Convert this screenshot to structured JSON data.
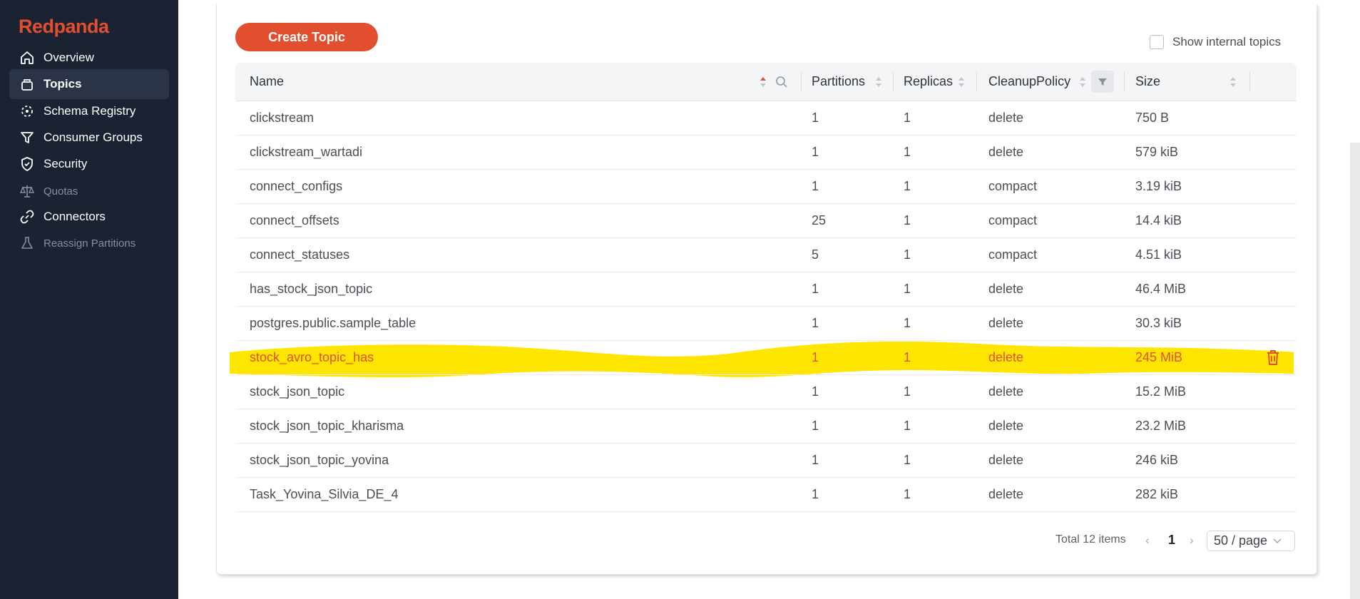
{
  "app": {
    "logo": "Redpanda"
  },
  "sidebar": {
    "items": [
      {
        "label": "Overview",
        "icon": "home-icon",
        "active": false,
        "disabled": false
      },
      {
        "label": "Topics",
        "icon": "box-icon",
        "active": true,
        "disabled": false
      },
      {
        "label": "Schema Registry",
        "icon": "schema-icon",
        "active": false,
        "disabled": false
      },
      {
        "label": "Consumer Groups",
        "icon": "funnel-icon",
        "active": false,
        "disabled": false
      },
      {
        "label": "Security",
        "icon": "shield-icon",
        "active": false,
        "disabled": false
      },
      {
        "label": "Quotas",
        "icon": "scale-icon",
        "active": false,
        "disabled": true
      },
      {
        "label": "Connectors",
        "icon": "link-icon",
        "active": false,
        "disabled": false
      },
      {
        "label": "Reassign Partitions",
        "icon": "flask-icon",
        "active": false,
        "disabled": true
      }
    ]
  },
  "toolbar": {
    "create_label": "Create Topic",
    "show_internal_label": "Show internal topics"
  },
  "table": {
    "columns": [
      "Name",
      "Partitions",
      "Replicas",
      "CleanupPolicy",
      "Size"
    ],
    "rows": [
      {
        "name": "clickstream",
        "partitions": "1",
        "replicas": "1",
        "policy": "delete",
        "size": "750 B"
      },
      {
        "name": "clickstream_wartadi",
        "partitions": "1",
        "replicas": "1",
        "policy": "delete",
        "size": "579 kiB"
      },
      {
        "name": "connect_configs",
        "partitions": "1",
        "replicas": "1",
        "policy": "compact",
        "size": "3.19 kiB"
      },
      {
        "name": "connect_offsets",
        "partitions": "25",
        "replicas": "1",
        "policy": "compact",
        "size": "14.4 kiB"
      },
      {
        "name": "connect_statuses",
        "partitions": "5",
        "replicas": "1",
        "policy": "compact",
        "size": "4.51 kiB"
      },
      {
        "name": "has_stock_json_topic",
        "partitions": "1",
        "replicas": "1",
        "policy": "delete",
        "size": "46.4 MiB"
      },
      {
        "name": "postgres.public.sample_table",
        "partitions": "1",
        "replicas": "1",
        "policy": "delete",
        "size": "30.3 kiB"
      },
      {
        "name": "stock_avro_topic_has",
        "partitions": "1",
        "replicas": "1",
        "policy": "delete",
        "size": "245 MiB"
      },
      {
        "name": "stock_json_topic",
        "partitions": "1",
        "replicas": "1",
        "policy": "delete",
        "size": "15.2 MiB"
      },
      {
        "name": "stock_json_topic_kharisma",
        "partitions": "1",
        "replicas": "1",
        "policy": "delete",
        "size": "23.2 MiB"
      },
      {
        "name": "stock_json_topic_yovina",
        "partitions": "1",
        "replicas": "1",
        "policy": "delete",
        "size": "246 kiB"
      },
      {
        "name": "Task_Yovina_Silvia_DE_4",
        "partitions": "1",
        "replicas": "1",
        "policy": "delete",
        "size": "282 kiB"
      }
    ]
  },
  "pagination": {
    "total": "Total 12 items",
    "current_page": "1",
    "page_size": "50 / page"
  },
  "colors": {
    "accent": "#e14f2f",
    "sidebar_bg": "#1b2333",
    "highlight": "#ffe600"
  }
}
